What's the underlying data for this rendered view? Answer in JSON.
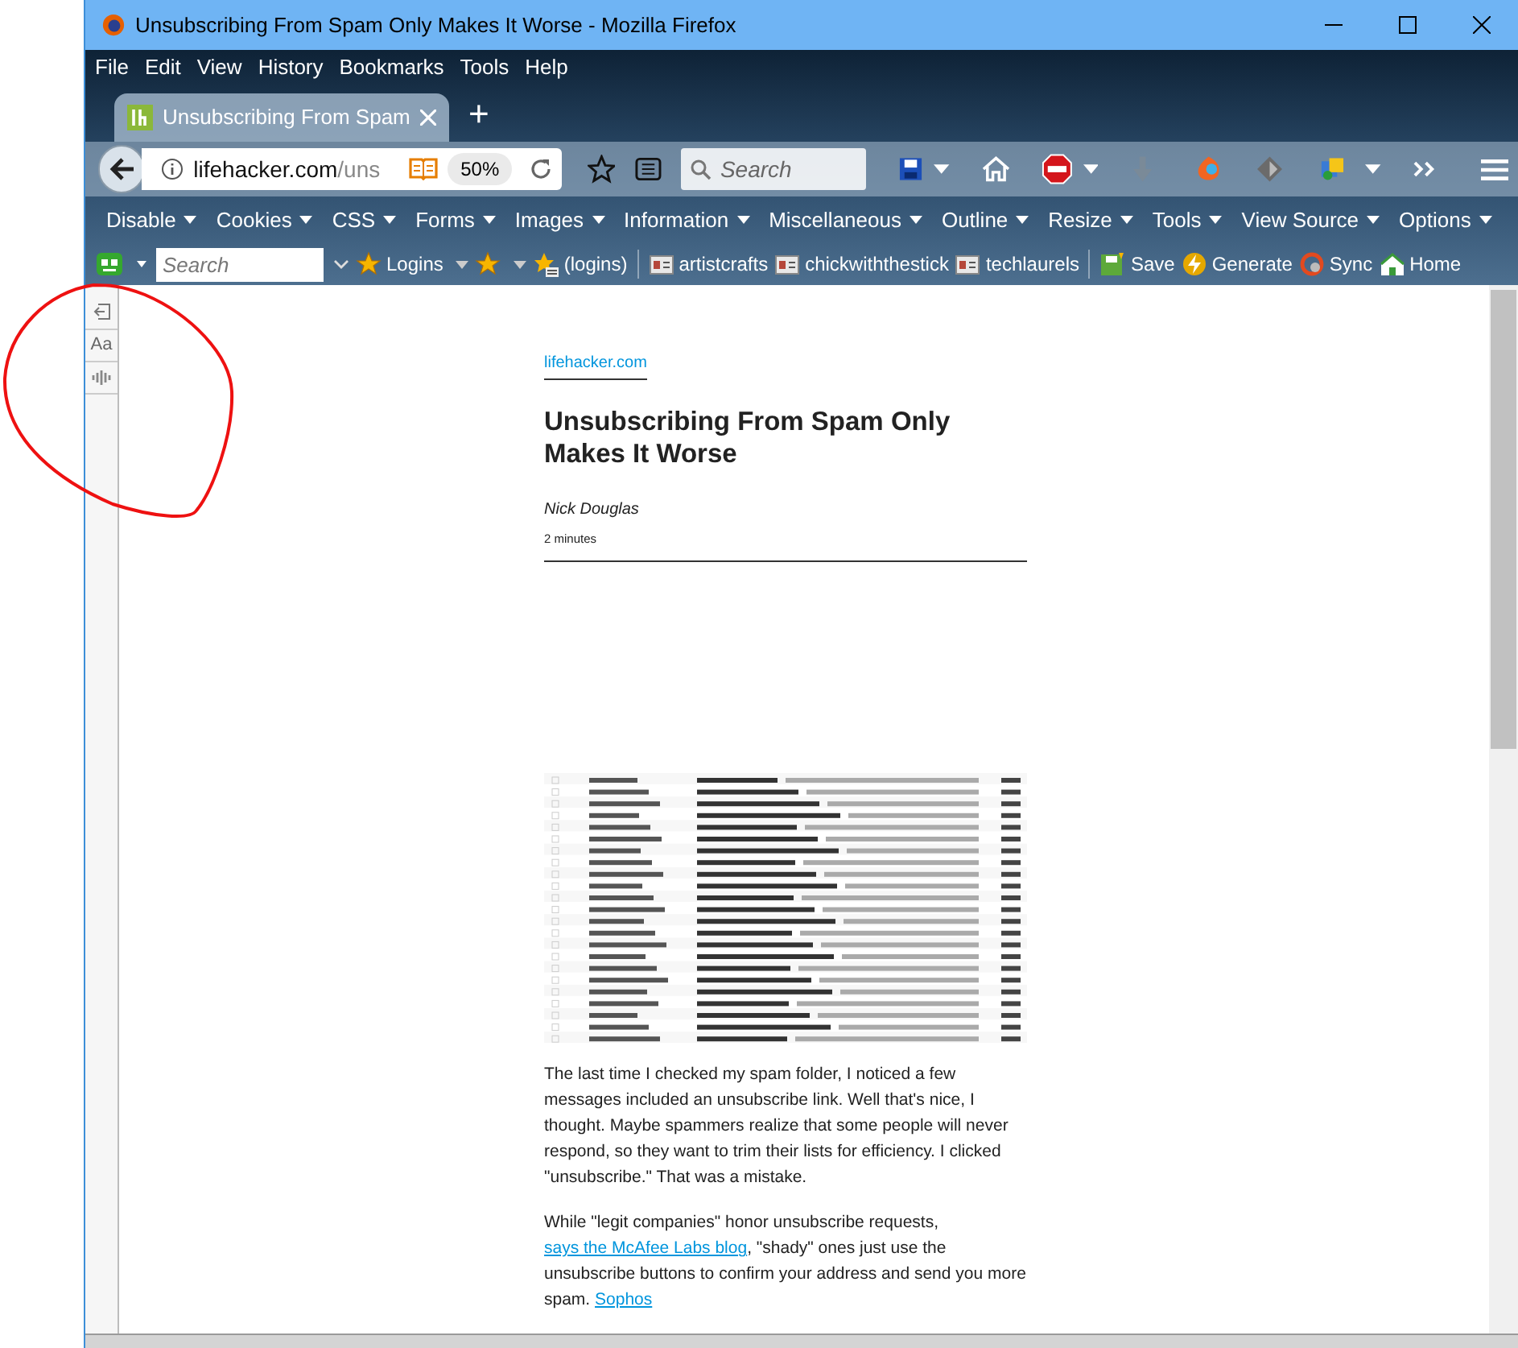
{
  "window": {
    "title": "Unsubscribing From Spam Only Makes It Worse - Mozilla Firefox"
  },
  "menu": [
    "File",
    "Edit",
    "View",
    "History",
    "Bookmarks",
    "Tools",
    "Help"
  ],
  "tabs": [
    {
      "title": "Unsubscribing From Spam",
      "selected": true
    }
  ],
  "new_tab": "+",
  "address": {
    "host": "lifehacker.com",
    "path": "/uns",
    "zoom": "50%"
  },
  "search": {
    "placeholder": "Search"
  },
  "webdev_menus": [
    "Disable",
    "Cookies",
    "CSS",
    "Forms",
    "Images",
    "Information",
    "Miscellaneous",
    "Outline",
    "Resize",
    "Tools",
    "View Source",
    "Options"
  ],
  "bookmarks_search": {
    "placeholder": "Search"
  },
  "bookmarks": [
    {
      "kind": "star",
      "label": "Logins",
      "menu": true
    },
    {
      "kind": "star",
      "menu": true
    },
    {
      "kind": "star-list",
      "label": "(logins)",
      "menu": false
    },
    {
      "kind": "card",
      "label": "artistcrafts",
      "menu": false
    },
    {
      "kind": "card",
      "label": "chickwiththestick",
      "menu": false
    },
    {
      "kind": "card",
      "label": "techlaurels",
      "menu": false
    },
    {
      "kind": "save",
      "label": "Save",
      "menu": false
    },
    {
      "kind": "bolt",
      "label": "Generate",
      "menu": false
    },
    {
      "kind": "sync",
      "label": "Sync",
      "menu": false
    },
    {
      "kind": "home",
      "label": "Home",
      "menu": false
    }
  ],
  "reader_toolbar": {
    "type_button": "Aa"
  },
  "article": {
    "site": "lifehacker.com",
    "title": "Unsubscribing From Spam Only Makes It Worse",
    "author": "Nick Douglas",
    "read_time": "2 minutes",
    "paragraphs": [
      [
        {
          "kind": "text",
          "text": "The last time I checked my spam folder, I noticed a few messages included an unsubscribe link. Well that's nice, I thought. Maybe spammers realize that some people will never respond, so they want to trim their lists for efficiency. I clicked \"unsubscribe.\" That was a mistake."
        }
      ],
      [
        {
          "kind": "text",
          "text": "While \"legit companies\" honor unsubscribe requests, "
        },
        {
          "kind": "link",
          "text": "says the McAfee Labs blog"
        },
        {
          "kind": "text",
          "text": ", \"shady\" ones just use the unsubscribe buttons to confirm your address and send you more spam. "
        },
        {
          "kind": "link",
          "text": "Sophos"
        }
      ]
    ]
  }
}
